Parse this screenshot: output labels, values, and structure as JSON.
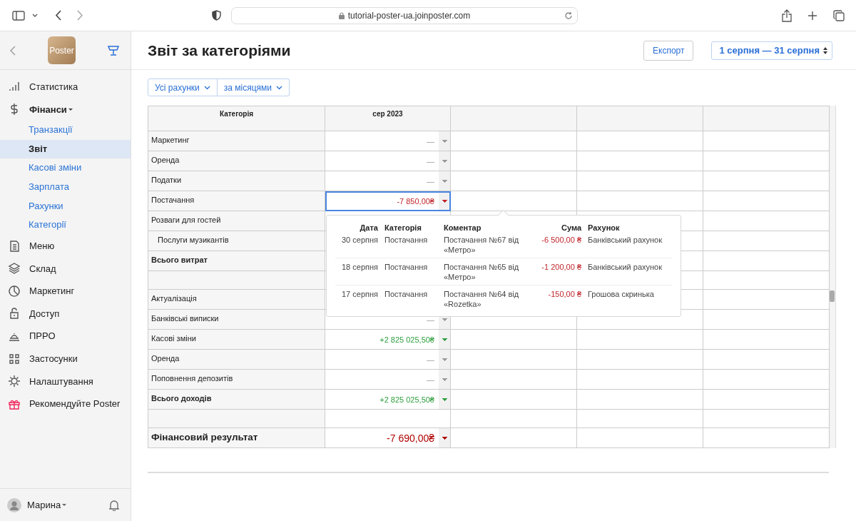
{
  "browser": {
    "url": "tutorial-poster-ua.joinposter.com"
  },
  "sidebar": {
    "logo": "Poster",
    "items": [
      {
        "label": "Статистика",
        "kind": "link"
      },
      {
        "label": "Фінанси",
        "kind": "link",
        "expanded": true,
        "children": [
          {
            "label": "Транзакції",
            "selected": false
          },
          {
            "label": "Звіт",
            "selected": true
          },
          {
            "label": "Касові зміни",
            "selected": false
          },
          {
            "label": "Зарплата",
            "selected": false
          },
          {
            "label": "Рахунки",
            "selected": false
          },
          {
            "label": "Категорії",
            "selected": false
          }
        ]
      },
      {
        "label": "Меню",
        "kind": "link"
      },
      {
        "label": "Склад",
        "kind": "link"
      },
      {
        "label": "Маркетинг",
        "kind": "link"
      },
      {
        "label": "Доступ",
        "kind": "link"
      },
      {
        "label": "ПРРО",
        "kind": "link"
      },
      {
        "label": "Застосунки",
        "kind": "link"
      },
      {
        "label": "Налаштування",
        "kind": "link"
      },
      {
        "label": "Рекомендуйте Poster",
        "kind": "promo"
      }
    ],
    "user": "Марина"
  },
  "page": {
    "title": "Звіт за категоріями",
    "export": "Експорт",
    "period": "1 серпня — 31 серпня"
  },
  "filters": [
    "Усі рахунки",
    "за місяцями"
  ],
  "table": {
    "columns": [
      "Категорія",
      "сер 2023"
    ],
    "rows": [
      {
        "kind": "item",
        "label": "Маркетинг",
        "value": "—",
        "color": "#999999",
        "selected": false
      },
      {
        "kind": "item",
        "label": "Оренда",
        "value": "—",
        "color": "#999999",
        "selected": false
      },
      {
        "kind": "item",
        "label": "Податки",
        "value": "—",
        "color": "#999999",
        "selected": false
      },
      {
        "kind": "item",
        "label": "Постачання",
        "value": "-7 850,00₴",
        "color": "#c0262d",
        "selected": true
      },
      {
        "kind": "item",
        "label": "Розваги для гостей",
        "selected": false
      },
      {
        "kind": "sub",
        "label": "Послуги музикантів",
        "selected": false
      },
      {
        "kind": "total",
        "label": "Всього витрат",
        "selected": false
      },
      {
        "kind": "spacer",
        "selected": false
      },
      {
        "kind": "item",
        "label": "Актуалізація",
        "selected": false
      },
      {
        "kind": "item",
        "label": "Банківські виписки",
        "value": "—",
        "color": "#999999",
        "selected": false
      },
      {
        "kind": "item",
        "label": "Касові зміни",
        "value": "+2 825 025,50₴",
        "color": "#2e9e3e",
        "selected": false
      },
      {
        "kind": "item",
        "label": "Оренда",
        "value": "—",
        "color": "#999999",
        "selected": false
      },
      {
        "kind": "item",
        "label": "Поповнення депозитів",
        "value": "—",
        "color": "#999999",
        "selected": false
      },
      {
        "kind": "total",
        "label": "Всього доходів",
        "value": "+2 825 025,50₴",
        "color": "#2e9e3e",
        "selected": false
      },
      {
        "kind": "spacer",
        "selected": false
      },
      {
        "kind": "result",
        "label": "Фінансовий результат",
        "value": "-7 690,00₴",
        "color": "#b00000",
        "selected": false
      }
    ]
  },
  "popover": {
    "columns": [
      "Дата",
      "Категорія",
      "Коментар",
      "Сума",
      "Рахунок"
    ],
    "rows": [
      {
        "date": "30 серпня",
        "category": "Постачання",
        "comment": "Постачання №67 від «Метро»",
        "amount": "-6 500,00 ₴",
        "account": "Банківський рахунок"
      },
      {
        "date": "18 серпня",
        "category": "Постачання",
        "comment": "Постачання №65 від «Метро»",
        "amount": "-1 200,00 ₴",
        "account": "Банківський рахунок"
      },
      {
        "date": "17 серпня",
        "category": "Постачання",
        "comment": "Постачання №64 від «Rozetka»",
        "amount": "-150,00 ₴",
        "account": "Грошова скринька"
      }
    ]
  }
}
